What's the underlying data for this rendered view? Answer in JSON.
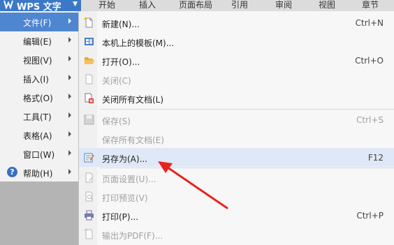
{
  "app": {
    "title": "WPS 文字",
    "icon": "wps-logo-icon"
  },
  "ribbon_tabs": [
    "开始",
    "插入",
    "页面布局",
    "引用",
    "审阅",
    "视图",
    "章节"
  ],
  "main_menu": [
    {
      "label": "文件(F)",
      "active": true
    },
    {
      "label": "编辑(E)"
    },
    {
      "label": "视图(V)"
    },
    {
      "label": "插入(I)"
    },
    {
      "label": "格式(O)"
    },
    {
      "label": "工具(T)"
    },
    {
      "label": "表格(A)"
    },
    {
      "label": "窗口(W)"
    },
    {
      "label": "帮助(H)",
      "icon": "help-icon",
      "icon_glyph": "?"
    }
  ],
  "file_submenu": [
    {
      "label": "新建(N)...",
      "shortcut": "Ctrl+N",
      "icon": "new-document-icon"
    },
    {
      "label": "本机上的模板(M)...",
      "shortcut": "",
      "icon": "template-icon"
    },
    {
      "label": "打开(O)...",
      "shortcut": "Ctrl+O",
      "icon": "open-folder-icon"
    },
    {
      "label": "关闭(C)",
      "shortcut": "",
      "icon": "close-document-icon",
      "disabled": true
    },
    {
      "label": "关闭所有文档(L)",
      "shortcut": "",
      "icon": "close-all-icon"
    },
    {
      "label": "保存(S)",
      "shortcut": "Ctrl+S",
      "icon": "save-icon",
      "disabled": true
    },
    {
      "label": "保存所有文档(E)",
      "shortcut": "",
      "icon": "",
      "disabled": true
    },
    {
      "label": "另存为(A)...",
      "shortcut": "F12",
      "icon": "save-as-icon",
      "highlighted": true
    },
    {
      "label": "页面设置(U)...",
      "shortcut": "",
      "icon": "page-setup-icon",
      "disabled": true
    },
    {
      "label": "打印预览(V)",
      "shortcut": "",
      "icon": "print-preview-icon",
      "disabled": true
    },
    {
      "label": "打印(P)...",
      "shortcut": "Ctrl+P",
      "icon": "print-icon"
    },
    {
      "label": "输出为PDF(F)...",
      "shortcut": "",
      "icon": "export-pdf-icon",
      "disabled": true
    }
  ],
  "colors": {
    "accent": "#4e86d0",
    "highlight": "#dfe8f6",
    "annotation_arrow": "#e8231e"
  }
}
